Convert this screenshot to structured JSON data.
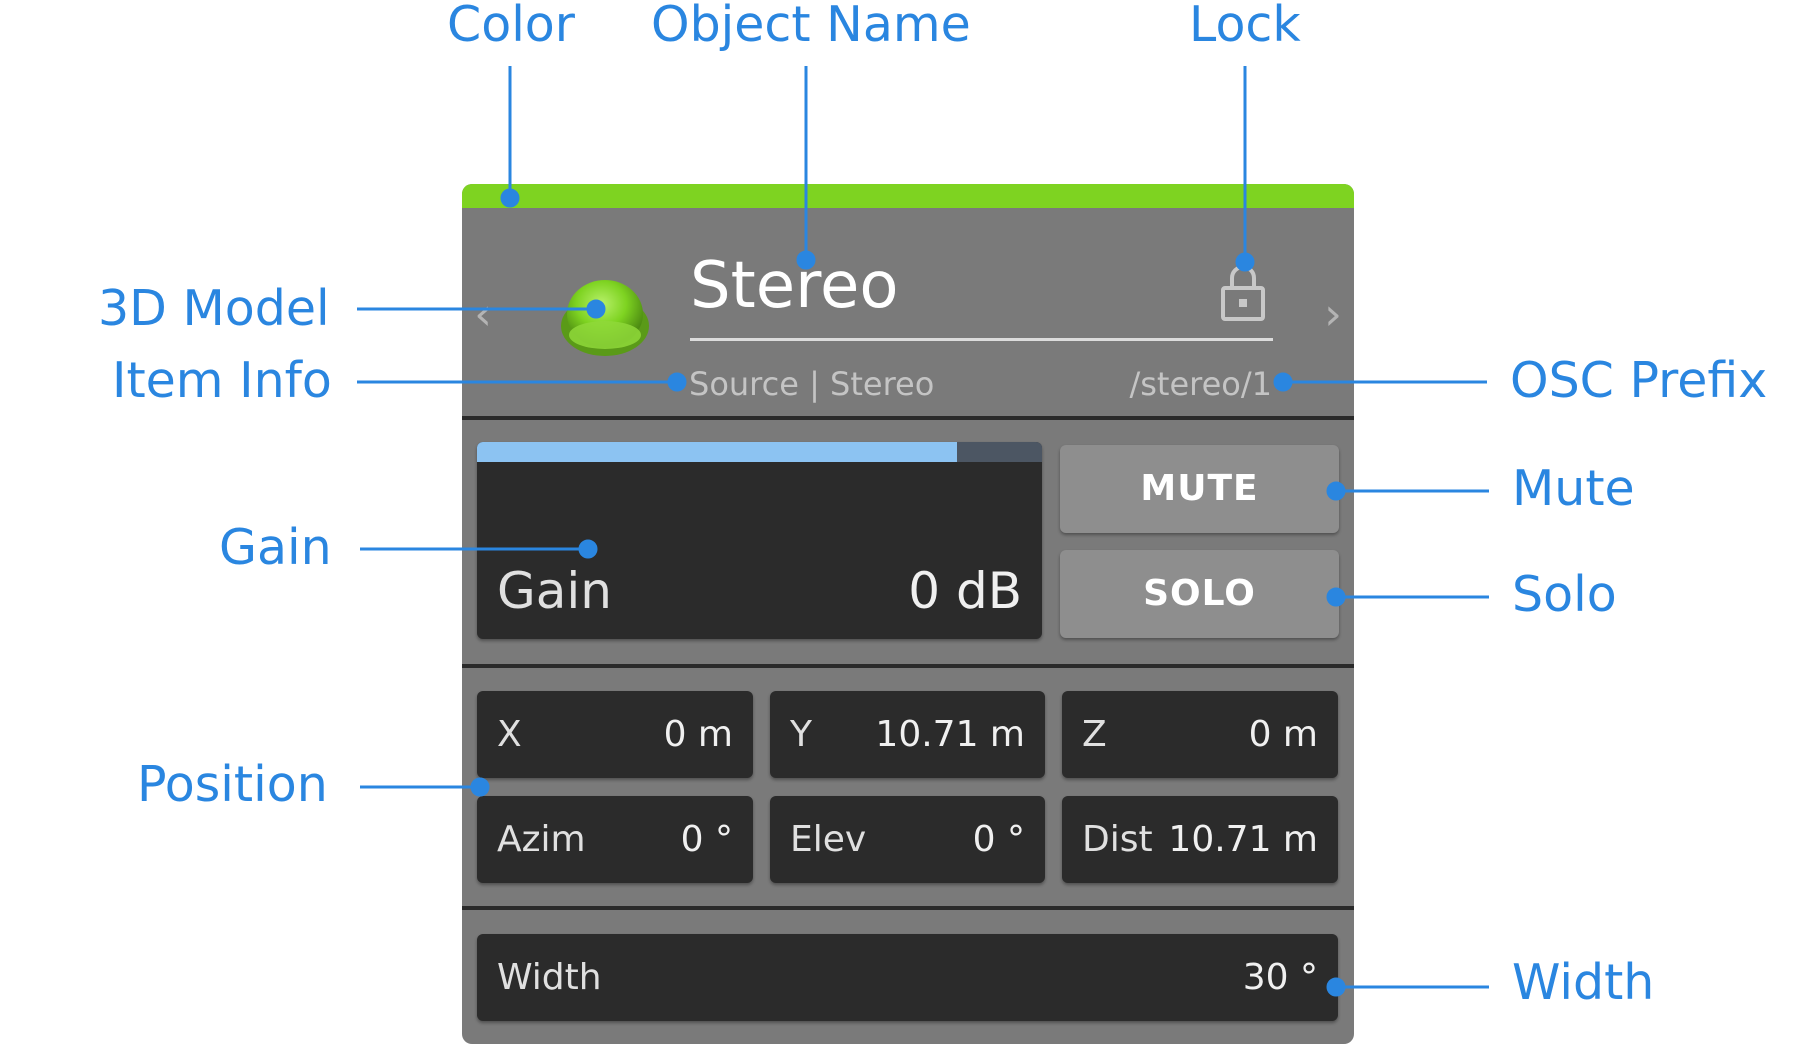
{
  "callouts": {
    "color": "Color",
    "object_name": "Object Name",
    "lock": "Lock",
    "model_3d": "3D Model",
    "item_info": "Item Info",
    "osc_prefix": "OSC Prefix",
    "mute": "Mute",
    "gain": "Gain",
    "solo": "Solo",
    "position": "Position",
    "width": "Width"
  },
  "panel": {
    "accent_color": "#7ed321",
    "nav_prev": "‹",
    "nav_next": "›",
    "model_icon": "sphere-icon",
    "lock_icon": "lock-icon",
    "object_name": "Stereo",
    "item_info": "Source | Stereo",
    "osc_prefix": "/stereo/1",
    "gain": {
      "label": "Gain",
      "value": "0 dB",
      "level_fraction": 0.85
    },
    "mute_label": "MUTE",
    "solo_label": "SOLO",
    "position": {
      "x": {
        "label": "X",
        "value": "0 m"
      },
      "y": {
        "label": "Y",
        "value": "10.71 m"
      },
      "z": {
        "label": "Z",
        "value": "0 m"
      },
      "azim": {
        "label": "Azim",
        "value": "0 °"
      },
      "elev": {
        "label": "Elev",
        "value": "0 °"
      },
      "dist": {
        "label": "Dist",
        "value": "10.71 m"
      }
    },
    "width": {
      "label": "Width",
      "value": "30 °"
    }
  },
  "colors": {
    "callout": "#2a86e0",
    "panel_bg": "#7a7a7a",
    "field_bg": "#2b2b2b",
    "button_bg": "#8e8e8e",
    "gain_fill": "#8cc3f2"
  }
}
